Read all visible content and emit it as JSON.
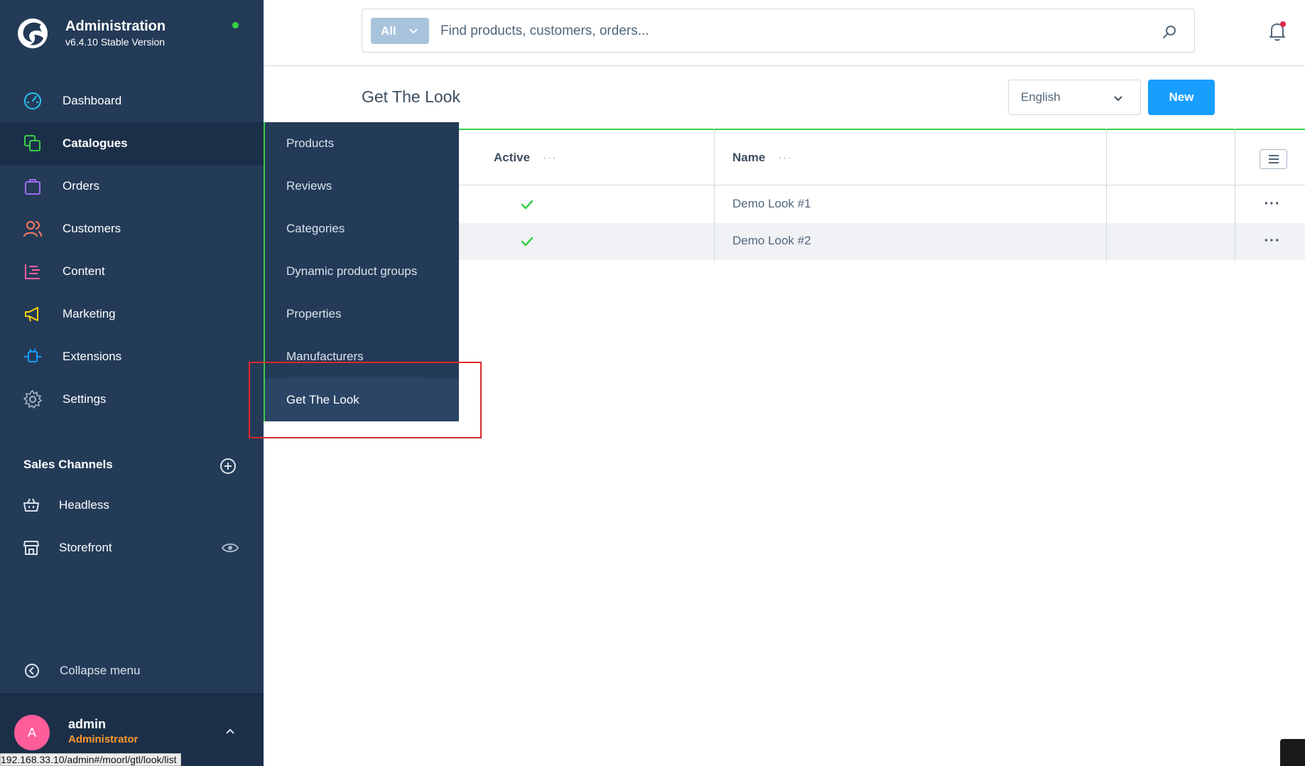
{
  "brand": {
    "title": "Administration",
    "version": "v6.4.10 Stable Version"
  },
  "nav": {
    "items": [
      {
        "label": "Dashboard",
        "icon": "dashboard-icon"
      },
      {
        "label": "Catalogues",
        "icon": "catalogues-icon"
      },
      {
        "label": "Orders",
        "icon": "orders-icon"
      },
      {
        "label": "Customers",
        "icon": "customers-icon"
      },
      {
        "label": "Content",
        "icon": "content-icon"
      },
      {
        "label": "Marketing",
        "icon": "marketing-icon"
      },
      {
        "label": "Extensions",
        "icon": "extensions-icon"
      },
      {
        "label": "Settings",
        "icon": "settings-icon"
      }
    ],
    "active": "Catalogues"
  },
  "sales_channels": {
    "title": "Sales Channels",
    "items": [
      {
        "label": "Headless"
      },
      {
        "label": "Storefront"
      }
    ]
  },
  "collapse_label": "Collapse menu",
  "user": {
    "initial": "A",
    "name": "admin",
    "role": "Administrator"
  },
  "status_url": "192.168.33.10/admin#/moorl/gtl/look/list",
  "flyout": {
    "items": [
      {
        "label": "Products"
      },
      {
        "label": "Reviews"
      },
      {
        "label": "Categories"
      },
      {
        "label": "Dynamic product groups"
      },
      {
        "label": "Properties"
      },
      {
        "label": "Manufacturers"
      },
      {
        "label": "Get The Look"
      }
    ],
    "active": "Get The Look"
  },
  "search": {
    "type_label": "All",
    "placeholder": "Find products, customers, orders..."
  },
  "page": {
    "title": "Get The Look",
    "language": "English",
    "new_label": "New"
  },
  "grid": {
    "columns": [
      {
        "label": "Active",
        "menu": "···"
      },
      {
        "label": "Name",
        "menu": "···"
      }
    ],
    "rows": [
      {
        "active": true,
        "name": "Demo Look #1",
        "actions": "···"
      },
      {
        "active": true,
        "name": "Demo Look #2",
        "actions": "···"
      }
    ]
  },
  "colors": {
    "sidebar": "#243b58",
    "sidebar_active": "#1c2f48",
    "accent": "#189eff",
    "success": "#37d046",
    "avatar": "#ff5c9a",
    "role": "#ff9a2e",
    "highlight": "#d92b2b"
  }
}
